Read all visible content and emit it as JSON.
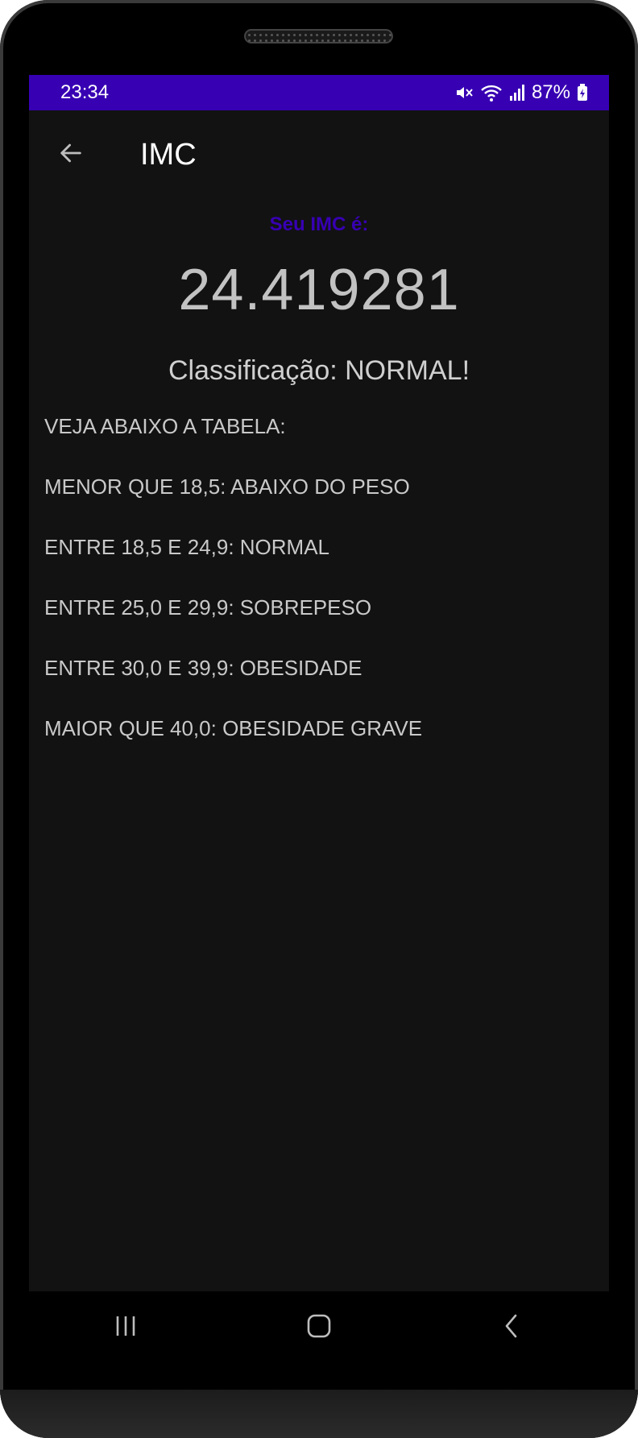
{
  "status_bar": {
    "time": "23:34",
    "battery": "87%",
    "icons": [
      "mute-icon",
      "wifi-icon",
      "signal-icon",
      "battery-charging-icon"
    ]
  },
  "app_bar": {
    "title": "IMC",
    "back_icon": "arrow-left-icon"
  },
  "result": {
    "label": "Seu IMC é:",
    "value": "24.419281",
    "classification": "Classificação: NORMAL!"
  },
  "table": {
    "title": "VEJA ABAIXO A TABELA:",
    "rows": [
      "MENOR QUE 18,5: ABAIXO DO PESO",
      "ENTRE 18,5 E 24,9: NORMAL",
      "ENTRE 25,0 E 29,9: SOBREPESO",
      "ENTRE 30,0 E 39,9: OBESIDADE",
      "MAIOR QUE 40,0: OBESIDADE GRAVE"
    ]
  },
  "nav_bar": {
    "icons": [
      "recent-apps-icon",
      "home-icon",
      "back-icon"
    ]
  },
  "colors": {
    "accent": "#3700b3",
    "background": "#121212"
  }
}
